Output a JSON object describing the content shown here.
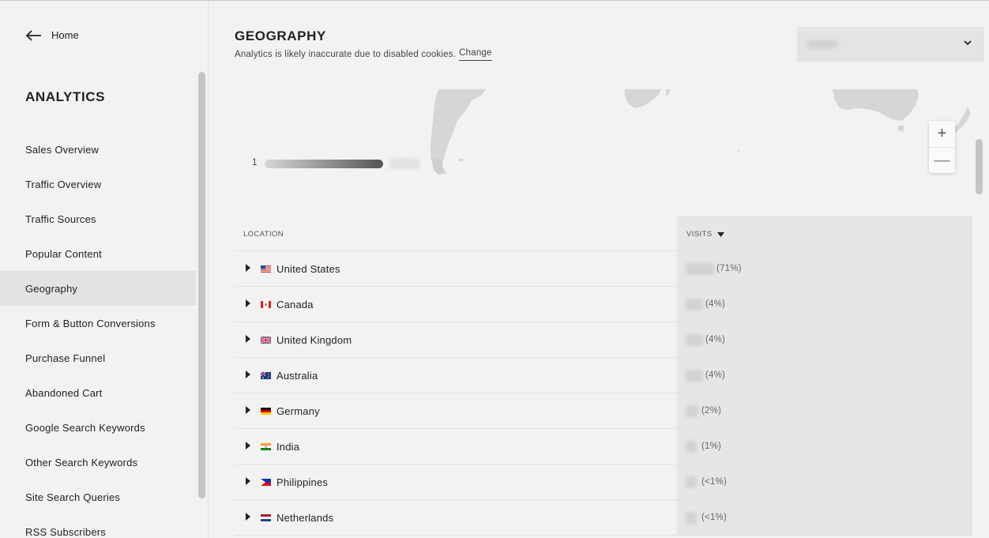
{
  "nav": {
    "home_label": "Home"
  },
  "sidebar": {
    "heading": "ANALYTICS",
    "items": [
      {
        "label": "Sales Overview",
        "active": false
      },
      {
        "label": "Traffic Overview",
        "active": false
      },
      {
        "label": "Traffic Sources",
        "active": false
      },
      {
        "label": "Popular Content",
        "active": false
      },
      {
        "label": "Geography",
        "active": true
      },
      {
        "label": "Form & Button Conversions",
        "active": false
      },
      {
        "label": "Purchase Funnel",
        "active": false
      },
      {
        "label": "Abandoned Cart",
        "active": false
      },
      {
        "label": "Google Search Keywords",
        "active": false
      },
      {
        "label": "Other Search Keywords",
        "active": false
      },
      {
        "label": "Site Search Queries",
        "active": false
      },
      {
        "label": "RSS Subscribers",
        "active": false
      }
    ]
  },
  "header": {
    "title": "GEOGRAPHY",
    "notice": "Analytics is likely inaccurate due to disabled cookies.",
    "change_link": "Change"
  },
  "map": {
    "legend_min": "1",
    "zoom_in": "+",
    "zoom_out": "—"
  },
  "table": {
    "col_location": "LOCATION",
    "col_visits": "VISITS",
    "rows": [
      {
        "country": "United States",
        "flag": "us-flag-icon",
        "pct": "(71%)"
      },
      {
        "country": "Canada",
        "flag": "ca-flag-icon",
        "pct": "(4%)"
      },
      {
        "country": "United Kingdom",
        "flag": "gb-flag-icon",
        "pct": "(4%)"
      },
      {
        "country": "Australia",
        "flag": "au-flag-icon",
        "pct": "(4%)"
      },
      {
        "country": "Germany",
        "flag": "de-flag-icon",
        "pct": "(2%)"
      },
      {
        "country": "India",
        "flag": "in-flag-icon",
        "pct": "(1%)"
      },
      {
        "country": "Philippines",
        "flag": "ph-flag-icon",
        "pct": "(<1%)"
      },
      {
        "country": "Netherlands",
        "flag": "nl-flag-icon",
        "pct": "(<1%)"
      }
    ]
  },
  "colors": {
    "background": "#f2f2f2",
    "active_item": "#e3e3e3",
    "visits_column": "#e6e6e6",
    "land": "#d6d6d6"
  }
}
